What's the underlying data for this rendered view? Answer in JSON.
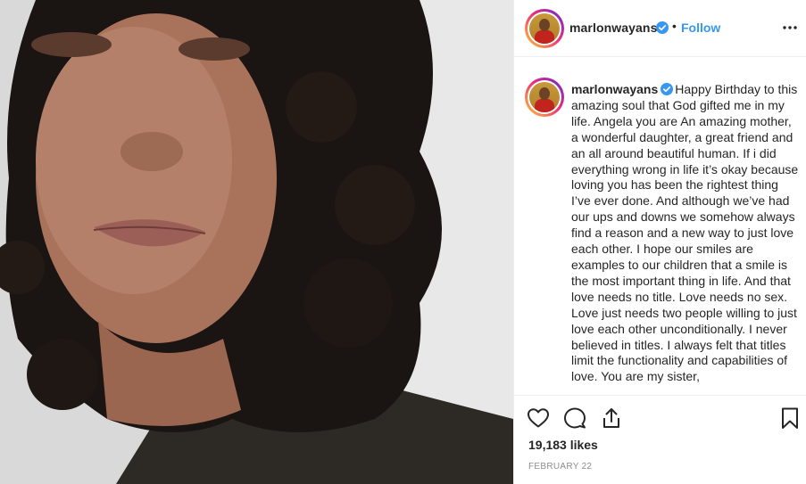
{
  "post": {
    "image_alt": "Selfie photo of a smiling woman with curly hair",
    "header": {
      "username": "marlonwayans",
      "separator": "•",
      "follow_label": "Follow"
    },
    "caption": {
      "username": "marlonwayans",
      "text": "Happy Birthday to this amazing soul that God gifted me in my life. Angela you are An amazing mother, a wonderful daughter, a great friend and an all around beautiful human. If i did everything wrong in life it’s okay because loving you has been the rightest thing I’ve ever done. And although we’ve had our ups and downs we somehow always find a reason and a new way to just love each other. I hope our smiles are examples to our children that a smile is the most important thing in life. And that love needs no title. Love needs no sex. Love just needs two people willing to just love each other unconditionally. I never believed in titles. I always felt that titles limit the functionality and capabilities of love. You are my sister,"
    },
    "likes": "19,183 likes",
    "date": "FEBRUARY 22"
  },
  "icons": {
    "verified": "verified-badge-icon",
    "more": "more-options-icon",
    "like": "heart-icon",
    "comment": "comment-icon",
    "share": "share-icon",
    "save": "bookmark-icon"
  },
  "colors": {
    "link_blue": "#3897f0",
    "verified_blue": "#3897f0",
    "text": "#262626",
    "muted": "#8e8e8e",
    "border": "#efefef"
  }
}
